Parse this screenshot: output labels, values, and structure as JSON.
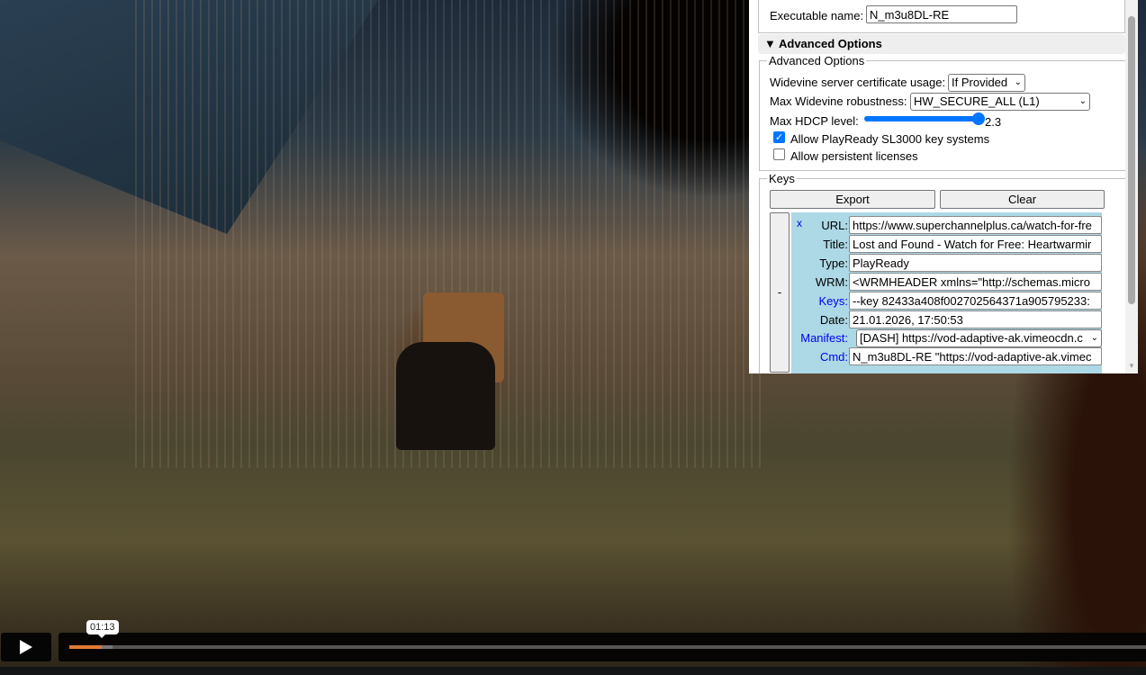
{
  "video": {
    "tooltip_time": "01:13",
    "progress_percent": 3,
    "buffered_percent": 4
  },
  "panel": {
    "executable_label": "Executable name:",
    "executable_value": "N_m3u8DL-RE",
    "advanced_summary": "Advanced Options",
    "advanced_legend": "Advanced Options",
    "cert_label": "Widevine server certificate usage:",
    "cert_value": "If Provided",
    "robustness_label": "Max Widevine robustness:",
    "robustness_value": "HW_SECURE_ALL (L1)",
    "hdcp_label": "Max HDCP level:",
    "hdcp_value": "2.3",
    "sl3000_label": "Allow PlayReady SL3000 key systems",
    "sl3000_checked": true,
    "persistent_label": "Allow persistent licenses",
    "persistent_checked": false,
    "keys_legend": "Keys",
    "export_label": "Export",
    "clear_label": "Clear",
    "collapse_label": "-",
    "remove_label": "x",
    "entry": {
      "url_label": "URL:",
      "url": "https://www.superchannelplus.ca/watch-for-fre",
      "title_label": "Title:",
      "title": "Lost and Found - Watch for Free: Heartwarmir",
      "type_label": "Type:",
      "type": "PlayReady",
      "wrm_label": "WRM:",
      "wrm": "<WRMHEADER xmlns=\"http://schemas.micro",
      "keys_label": "Keys:",
      "keys": "--key 82433a408f002702564371a905795233:",
      "date_label": "Date:",
      "date": "21.01.2026, 17:50:53",
      "manifest_label": "Manifest:",
      "manifest": "[DASH] https://vod-adaptive-ak.vimeocdn.c",
      "cmd_label": "Cmd:",
      "cmd": "N_m3u8DL-RE \"https://vod-adaptive-ak.vimec"
    }
  }
}
